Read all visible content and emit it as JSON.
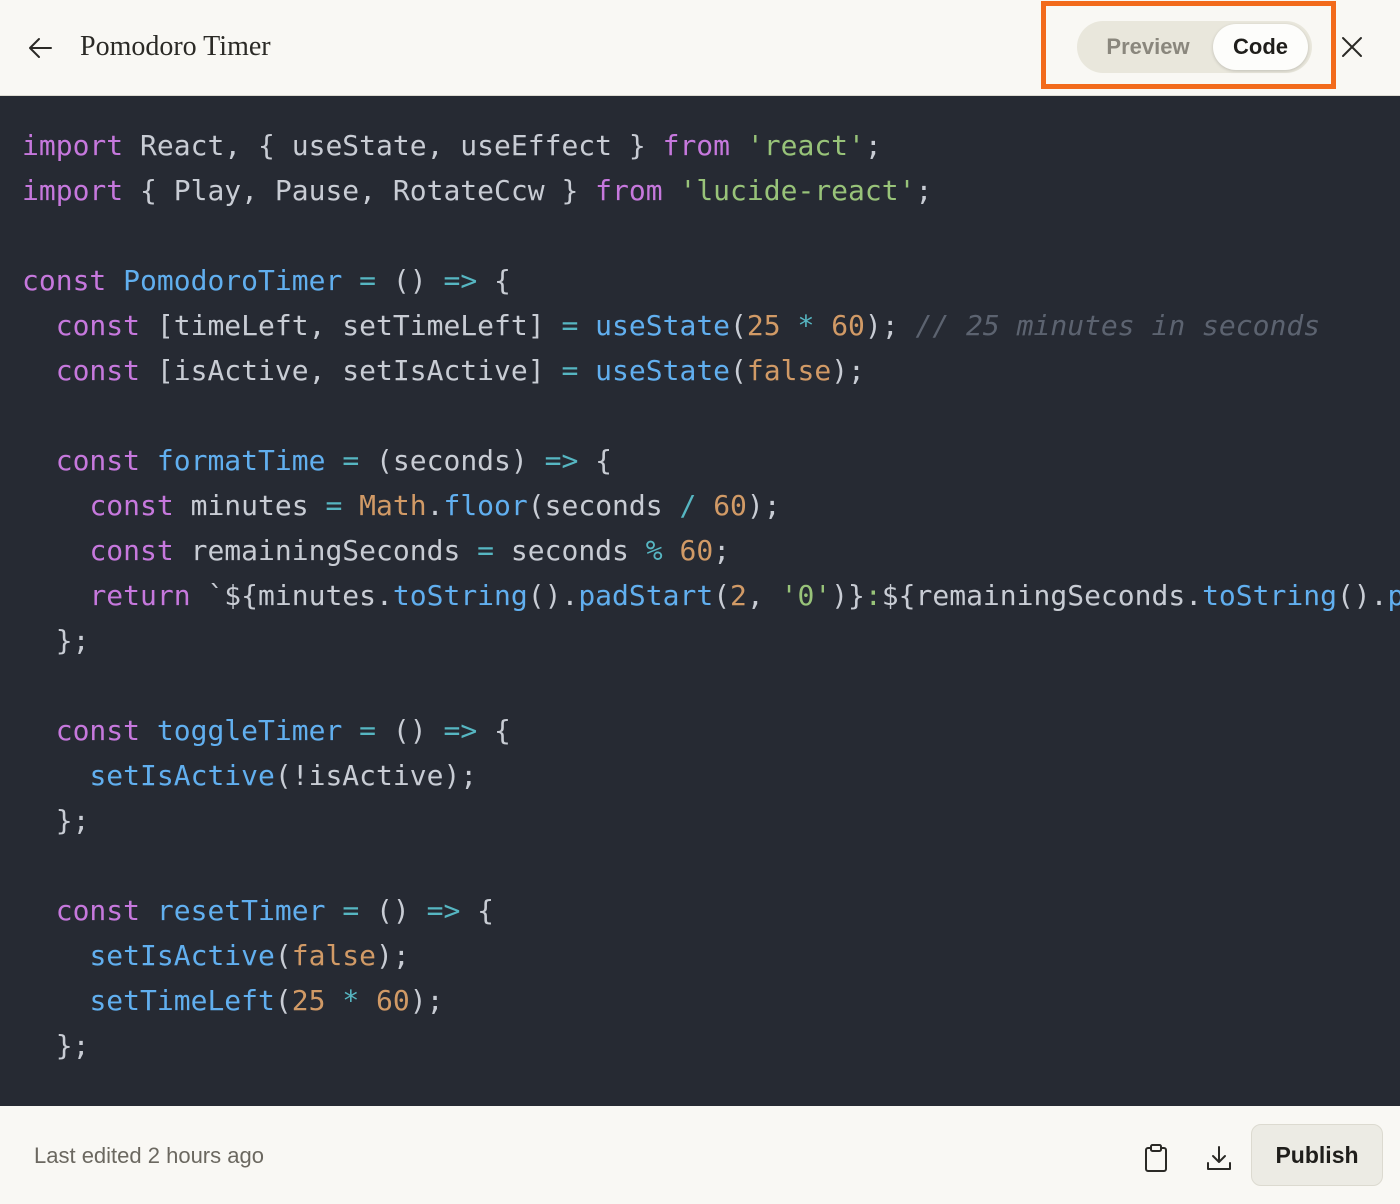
{
  "header": {
    "title": "Pomodoro Timer",
    "back_icon": "arrow-left-icon",
    "close_icon": "close-icon",
    "view_toggle": {
      "options": [
        "Preview",
        "Code"
      ],
      "selected": "Code"
    }
  },
  "highlight_color": "#f26a1b",
  "code_theme": {
    "background": "#262a33",
    "keyword": "#c678dd",
    "function": "#61afef",
    "string": "#98c379",
    "number": "#d19a66",
    "comment": "#5c6370"
  },
  "code_lines": [
    [
      [
        "k",
        "import"
      ],
      [
        "p",
        " React, { useState, useEffect } "
      ],
      [
        "k",
        "from"
      ],
      [
        "p",
        " "
      ],
      [
        "s",
        "'react'"
      ],
      [
        "p",
        ";"
      ]
    ],
    [
      [
        "k",
        "import"
      ],
      [
        "p",
        " { Play, Pause, RotateCcw } "
      ],
      [
        "k",
        "from"
      ],
      [
        "p",
        " "
      ],
      [
        "s",
        "'lucide-react'"
      ],
      [
        "p",
        ";"
      ]
    ],
    [],
    [
      [
        "k",
        "const"
      ],
      [
        "p",
        " "
      ],
      [
        "f",
        "PomodoroTimer"
      ],
      [
        "p",
        " "
      ],
      [
        "o",
        "="
      ],
      [
        "p",
        " () "
      ],
      [
        "o",
        "=>"
      ],
      [
        "p",
        " {"
      ]
    ],
    [
      [
        "p",
        "  "
      ],
      [
        "k",
        "const"
      ],
      [
        "p",
        " [timeLeft, setTimeLeft] "
      ],
      [
        "o",
        "="
      ],
      [
        "p",
        " "
      ],
      [
        "f",
        "useState"
      ],
      [
        "p",
        "("
      ],
      [
        "n",
        "25"
      ],
      [
        "p",
        " "
      ],
      [
        "o",
        "*"
      ],
      [
        "p",
        " "
      ],
      [
        "n",
        "60"
      ],
      [
        "p",
        "); "
      ],
      [
        "c",
        "// 25 minutes in seconds"
      ]
    ],
    [
      [
        "p",
        "  "
      ],
      [
        "k",
        "const"
      ],
      [
        "p",
        " [isActive, setIsActive] "
      ],
      [
        "o",
        "="
      ],
      [
        "p",
        " "
      ],
      [
        "f",
        "useState"
      ],
      [
        "p",
        "("
      ],
      [
        "n",
        "false"
      ],
      [
        "p",
        ");"
      ]
    ],
    [],
    [
      [
        "p",
        "  "
      ],
      [
        "k",
        "const"
      ],
      [
        "p",
        " "
      ],
      [
        "f",
        "formatTime"
      ],
      [
        "p",
        " "
      ],
      [
        "o",
        "="
      ],
      [
        "p",
        " (seconds) "
      ],
      [
        "o",
        "=>"
      ],
      [
        "p",
        " {"
      ]
    ],
    [
      [
        "p",
        "    "
      ],
      [
        "k",
        "const"
      ],
      [
        "p",
        " minutes "
      ],
      [
        "o",
        "="
      ],
      [
        "p",
        " "
      ],
      [
        "n",
        "Math"
      ],
      [
        "p",
        "."
      ],
      [
        "f",
        "floor"
      ],
      [
        "p",
        "(seconds "
      ],
      [
        "o",
        "/"
      ],
      [
        "p",
        " "
      ],
      [
        "n",
        "60"
      ],
      [
        "p",
        ");"
      ]
    ],
    [
      [
        "p",
        "    "
      ],
      [
        "k",
        "const"
      ],
      [
        "p",
        " remainingSeconds "
      ],
      [
        "o",
        "="
      ],
      [
        "p",
        " seconds "
      ],
      [
        "o",
        "%"
      ],
      [
        "p",
        " "
      ],
      [
        "n",
        "60"
      ],
      [
        "p",
        ";"
      ]
    ],
    [
      [
        "p",
        "    "
      ],
      [
        "k",
        "return"
      ],
      [
        "p",
        " `${minutes."
      ],
      [
        "f",
        "toString"
      ],
      [
        "p",
        "()."
      ],
      [
        "f",
        "padStart"
      ],
      [
        "p",
        "("
      ],
      [
        "n",
        "2"
      ],
      [
        "p",
        ", "
      ],
      [
        "s",
        "'0'"
      ],
      [
        "p",
        ")}"
      ],
      [
        "s",
        ":"
      ],
      [
        "p",
        "${remainingSeconds."
      ],
      [
        "f",
        "toString"
      ],
      [
        "p",
        "()."
      ],
      [
        "f",
        "padStart"
      ],
      [
        "p",
        "("
      ]
    ],
    [
      [
        "p",
        "  };"
      ]
    ],
    [],
    [
      [
        "p",
        "  "
      ],
      [
        "k",
        "const"
      ],
      [
        "p",
        " "
      ],
      [
        "f",
        "toggleTimer"
      ],
      [
        "p",
        " "
      ],
      [
        "o",
        "="
      ],
      [
        "p",
        " () "
      ],
      [
        "o",
        "=>"
      ],
      [
        "p",
        " {"
      ]
    ],
    [
      [
        "p",
        "    "
      ],
      [
        "f",
        "setIsActive"
      ],
      [
        "p",
        "(!isActive);"
      ]
    ],
    [
      [
        "p",
        "  };"
      ]
    ],
    [],
    [
      [
        "p",
        "  "
      ],
      [
        "k",
        "const"
      ],
      [
        "p",
        " "
      ],
      [
        "f",
        "resetTimer"
      ],
      [
        "p",
        " "
      ],
      [
        "o",
        "="
      ],
      [
        "p",
        " () "
      ],
      [
        "o",
        "=>"
      ],
      [
        "p",
        " {"
      ]
    ],
    [
      [
        "p",
        "    "
      ],
      [
        "f",
        "setIsActive"
      ],
      [
        "p",
        "("
      ],
      [
        "n",
        "false"
      ],
      [
        "p",
        ");"
      ]
    ],
    [
      [
        "p",
        "    "
      ],
      [
        "f",
        "setTimeLeft"
      ],
      [
        "p",
        "("
      ],
      [
        "n",
        "25"
      ],
      [
        "p",
        " "
      ],
      [
        "o",
        "*"
      ],
      [
        "p",
        " "
      ],
      [
        "n",
        "60"
      ],
      [
        "p",
        ");"
      ]
    ],
    [
      [
        "p",
        "  };"
      ]
    ]
  ],
  "footer": {
    "status": "Last edited 2 hours ago",
    "copy_icon": "clipboard-icon",
    "download_icon": "download-icon",
    "publish_label": "Publish"
  }
}
